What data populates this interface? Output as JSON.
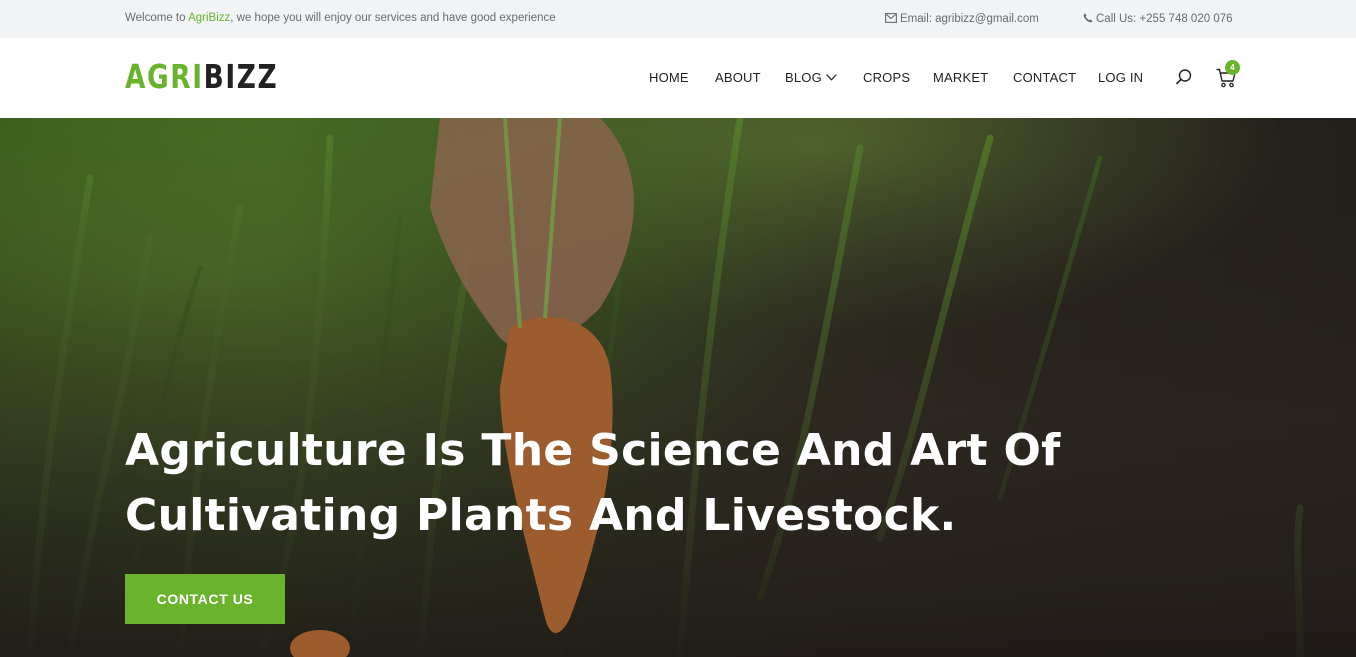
{
  "topbar": {
    "welcome_prefix": "Welcome to ",
    "welcome_brand": "AgriBizz",
    "welcome_suffix": ", we hope you will enjoy our services and have good experience",
    "email_label": "Email: agribizz@gmail.com",
    "phone_label": "Call Us: +255 748 020 076"
  },
  "logo": {
    "part1": "AGRI",
    "part2": "BIZZ"
  },
  "nav": {
    "items": [
      "HOME",
      "ABOUT",
      "BLOG",
      "CROPS",
      "MARKET",
      "CONTACT",
      "LOG IN"
    ]
  },
  "cart": {
    "count": "4"
  },
  "hero": {
    "title_line1": "Agriculture Is The Science And Art Of",
    "title_line2": "Cultivating Plants And Livestock.",
    "cta_label": "CONTACT US"
  },
  "colors": {
    "accent": "#6ab42d",
    "dark": "#222222",
    "topbar_bg": "#f1f3f5"
  },
  "icons": [
    "envelope-icon",
    "phone-icon",
    "chevron-down-icon",
    "search-icon",
    "cart-icon"
  ]
}
